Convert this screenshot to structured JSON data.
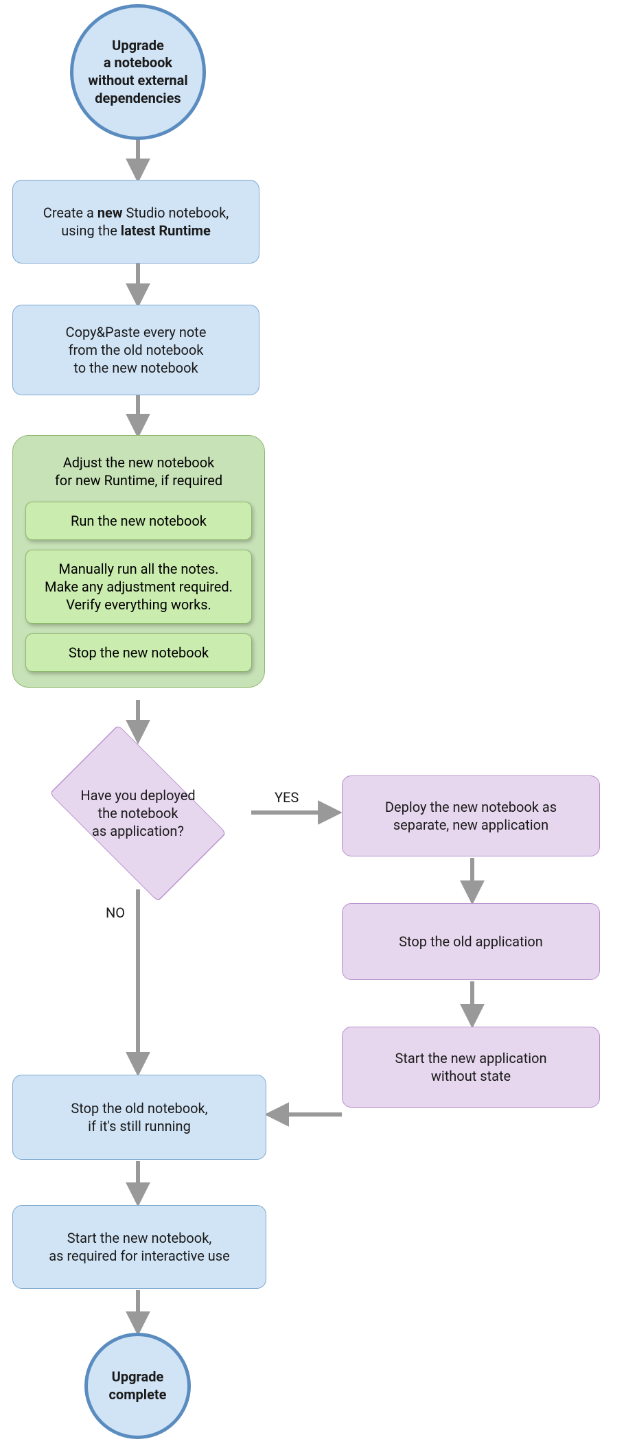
{
  "nodes": {
    "start": {
      "line1": "Upgrade",
      "line2": "a notebook",
      "line3": "without external",
      "line4": "dependencies"
    },
    "create": {
      "text_before_bold1": "Create a ",
      "bold1": "new",
      "text_mid": " Studio notebook, using the ",
      "bold2": "latest Runtime"
    },
    "copy": {
      "line1": "Copy&Paste every note",
      "line2": "from the old notebook",
      "line3": "to the new notebook"
    },
    "adjust_group": {
      "title_line1": "Adjust the new notebook",
      "title_line2": "for new Runtime, if required",
      "sub1": "Run the new notebook",
      "sub2_line1": "Manually run all the notes.",
      "sub2_line2": "Make any adjustment required.",
      "sub2_line3": "Verify everything works.",
      "sub3": "Stop the new notebook"
    },
    "decision": {
      "line1": "Have you deployed",
      "line2": "the notebook",
      "line3": "as application?"
    },
    "decision_yes": "YES",
    "decision_no": "NO",
    "deploy_new": {
      "line1": "Deploy the new notebook as",
      "line2": "separate, new application"
    },
    "stop_old_app": {
      "line": "Stop the old application"
    },
    "start_new_app": {
      "line1": "Start the new application",
      "line2": "without state"
    },
    "stop_old_nb": {
      "line1": "Stop the old notebook,",
      "line2": "if it's still running"
    },
    "start_new_nb": {
      "line1": "Start the new notebook,",
      "line2": "as required for interactive use"
    },
    "end": {
      "line1": "Upgrade",
      "line2": "complete"
    }
  },
  "colors": {
    "blue_fill": "#d1e4f6",
    "blue_stroke": "#7ca7cf",
    "circle_stroke": "#5a8cc0",
    "green_fill": "#c8e2b7",
    "green_sub_fill": "#caecaf",
    "green_stroke": "#8db86e",
    "purple_fill": "#e6d6ee",
    "purple_stroke": "#b98fce",
    "arrow": "#999999"
  }
}
